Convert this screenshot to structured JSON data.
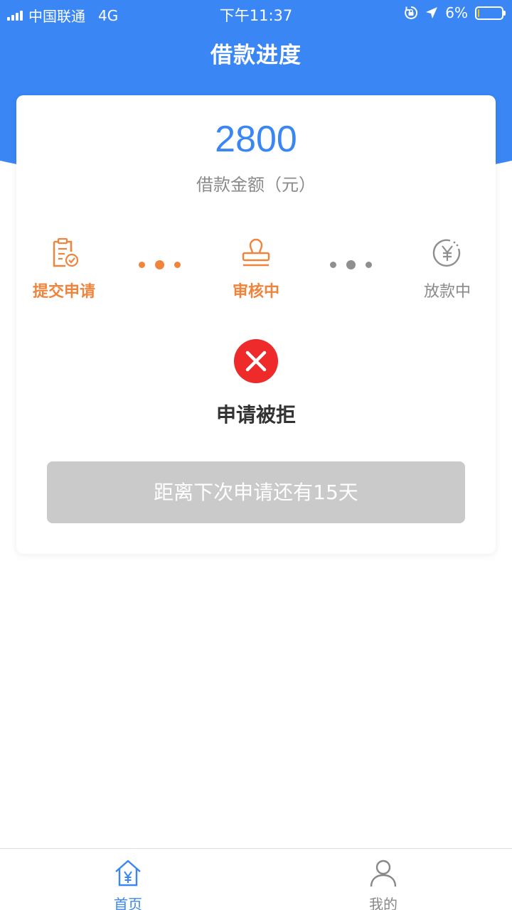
{
  "status_bar": {
    "carrier": "中国联通",
    "network": "4G",
    "time": "下午11:37",
    "battery": "6%",
    "battery_level": 0.06
  },
  "nav": {
    "title": "借款进度"
  },
  "loan": {
    "amount": "2800",
    "amount_label": "借款金额（元）"
  },
  "steps": [
    {
      "label": "提交申请",
      "icon": "document-check-icon",
      "state": "done"
    },
    {
      "label": "审核中",
      "icon": "stamp-icon",
      "state": "current"
    },
    {
      "label": "放款中",
      "icon": "yen-circle-icon",
      "state": "pending"
    }
  ],
  "result": {
    "icon": "close-circle-icon",
    "text": "申请被拒",
    "countdown_button": "距离下次申请还有15天"
  },
  "tabbar": {
    "items": [
      {
        "label": "首页",
        "icon": "home-yen-icon",
        "active": true
      },
      {
        "label": "我的",
        "icon": "user-icon",
        "active": false
      }
    ]
  },
  "colors": {
    "primary": "#3a86f5",
    "accent": "#f0843c",
    "danger": "#ee2a2a",
    "disabled": "#cacaca"
  }
}
